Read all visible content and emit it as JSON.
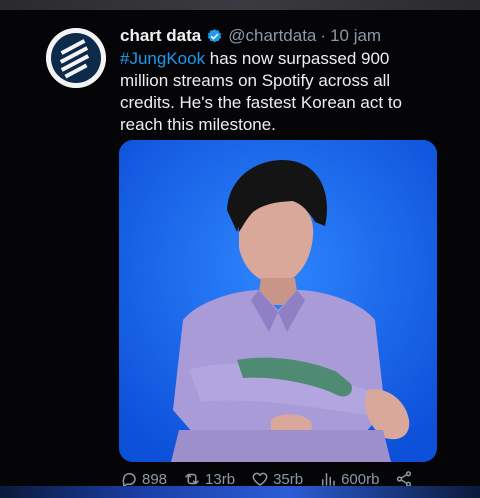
{
  "tweet": {
    "name": "chart data",
    "handle": "@chartdata",
    "separator": "·",
    "time": "10 jam",
    "hashtag": "#JungKook",
    "text": " has now surpassed 900 million streams on Spotify across all credits. He's the fastest Korean act to reach this milestone.",
    "media_icon": "photo-of-person",
    "counts": {
      "replies": "898",
      "retweets": "13rb",
      "likes": "35rb",
      "views": "600rb"
    }
  },
  "colors": {
    "background": "#050507",
    "hashtag": "#1d9bf0",
    "verified": "#1d9bf0",
    "muted": "#8b98a5",
    "media_bg": "#1660e8"
  }
}
